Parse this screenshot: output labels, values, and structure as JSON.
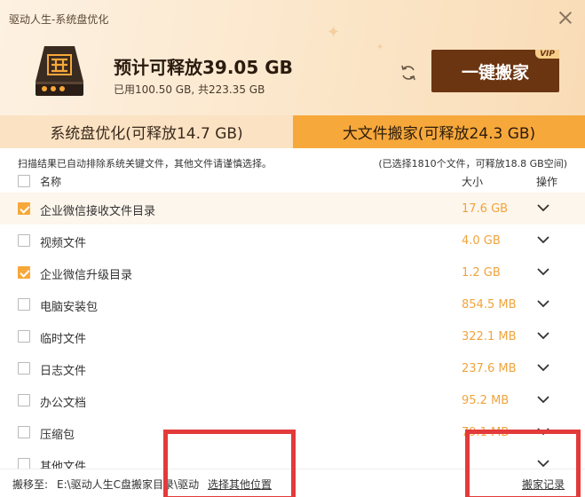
{
  "window": {
    "title": "驱动人生-系统盘优化"
  },
  "summary": {
    "headline": "预计可释放39.05 GB",
    "usage": "已用100.50 GB, 共223.35 GB",
    "move_button_label": "一键搬家",
    "vip_badge": "VIP"
  },
  "tabs": [
    {
      "label": "系统盘优化(可释放14.7 GB)",
      "active": false
    },
    {
      "label": "大文件搬家(可释放24.3 GB)",
      "active": true
    }
  ],
  "info": {
    "left": "扫描结果已自动排除系统关键文件，其他文件请谨慎选择。",
    "right": "(已选择1810个文件，可释放18.8 GB空间)"
  },
  "columns": {
    "name": "名称",
    "size": "大小",
    "action": "操作"
  },
  "rows": [
    {
      "name": "企业微信接收文件目录",
      "size": "17.6 GB",
      "checked": true,
      "highlighted": true
    },
    {
      "name": "视频文件",
      "size": "4.0 GB",
      "checked": false,
      "highlighted": false
    },
    {
      "name": "企业微信升级目录",
      "size": "1.2 GB",
      "checked": true,
      "highlighted": false
    },
    {
      "name": "电脑安装包",
      "size": "854.5 MB",
      "checked": false,
      "highlighted": false
    },
    {
      "name": "临时文件",
      "size": "322.1 MB",
      "checked": false,
      "highlighted": false
    },
    {
      "name": "日志文件",
      "size": "237.6 MB",
      "checked": false,
      "highlighted": false
    },
    {
      "name": "办公文档",
      "size": "95.2 MB",
      "checked": false,
      "highlighted": false
    },
    {
      "name": "压缩包",
      "size": "79.1 MB",
      "checked": false,
      "highlighted": false
    },
    {
      "name": "其他文件",
      "size": "",
      "checked": false,
      "highlighted": false
    }
  ],
  "footer": {
    "label": "搬移至:",
    "path": "E:\\驱动人生C盘搬家目录\\驱动",
    "choose_location": "选择其他位置",
    "history": "搬家记录"
  },
  "colors": {
    "accent": "#f7a83a",
    "button_brown": "#6b3511",
    "size_text": "#f0a43c",
    "annotation_red": "#e33a3a"
  }
}
